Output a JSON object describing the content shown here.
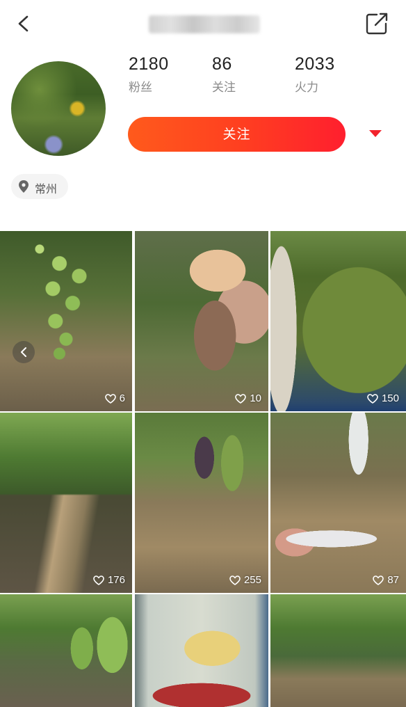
{
  "profile": {
    "stats": [
      {
        "value": "2180",
        "label": "粉丝"
      },
      {
        "value": "86",
        "label": "关注"
      },
      {
        "value": "2033",
        "label": "火力"
      }
    ],
    "follow_label": "关注",
    "location": "常州"
  },
  "posts": [
    {
      "likes": "6"
    },
    {
      "likes": "10"
    },
    {
      "likes": "150"
    },
    {
      "likes": "176"
    },
    {
      "likes": "255"
    },
    {
      "likes": "87"
    },
    {
      "likes": ""
    },
    {
      "likes": ""
    },
    {
      "likes": ""
    }
  ],
  "icons": {
    "back": "chevron-left-icon",
    "share": "share-icon",
    "location": "location-pin-icon",
    "likes": "heart-icon"
  },
  "colors": {
    "follow_gradient_start": "#ff5a1c",
    "follow_gradient_end": "#ff1f2e",
    "dropdown": "#f2232c"
  }
}
